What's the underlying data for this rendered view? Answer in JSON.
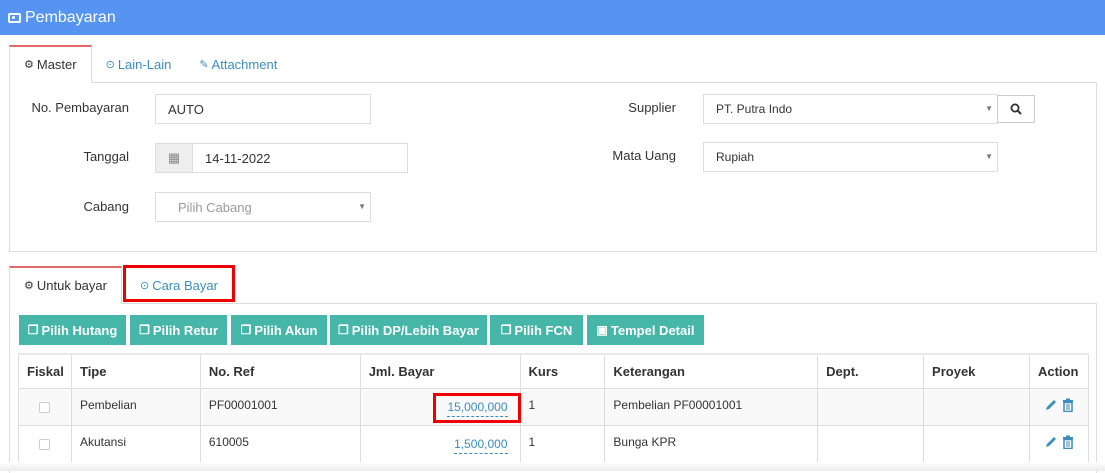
{
  "window": {
    "title": "Pembayaran"
  },
  "top_tabs": [
    {
      "label": "Master"
    },
    {
      "label": "Lain-Lain"
    },
    {
      "label": "Attachment"
    }
  ],
  "form": {
    "no_pembayaran": {
      "label": "No. Pembayaran",
      "value": "AUTO"
    },
    "tanggal": {
      "label": "Tanggal",
      "value": "14-11-2022"
    },
    "cabang": {
      "label": "Cabang",
      "placeholder": "Pilih Cabang"
    },
    "supplier": {
      "label": "Supplier",
      "value": "PT. Putra Indo"
    },
    "mata_uang": {
      "label": "Mata Uang",
      "value": "Rupiah"
    }
  },
  "bottom_tabs": [
    {
      "label": "Untuk bayar"
    },
    {
      "label": "Cara Bayar"
    }
  ],
  "toolbar": [
    {
      "label": "Pilih Hutang"
    },
    {
      "label": "Pilih Retur"
    },
    {
      "label": "Pilih Akun"
    },
    {
      "label": "Pilih DP/Lebih Bayar"
    },
    {
      "label": "Pilih FCN"
    },
    {
      "label": "Tempel Detail"
    }
  ],
  "table": {
    "headers": [
      "Fiskal",
      "Tipe",
      "No. Ref",
      "Jml. Bayar",
      "Kurs",
      "Keterangan",
      "Dept.",
      "Proyek",
      "Action"
    ],
    "rows": [
      {
        "tipe": "Pembelian",
        "no_ref": "PF00001001",
        "jml_bayar": "15,000,000",
        "kurs": "1",
        "keterangan": "Pembelian PF00001001",
        "dept": "",
        "proyek": ""
      },
      {
        "tipe": "Akutansi",
        "no_ref": "610005",
        "jml_bayar": "1,500,000",
        "kurs": "1",
        "keterangan": "Bunga KPR",
        "dept": "",
        "proyek": ""
      }
    ]
  },
  "colors": {
    "header": "#5594f0",
    "button": "#45b6a8",
    "link": "#3c8dbc",
    "highlight": "#ee0000"
  },
  "icons": [
    "money-icon",
    "cogs-icon",
    "check-circle-icon",
    "paperclip-icon",
    "calendar-icon",
    "search-icon",
    "copy-icon",
    "paste-icon",
    "pencil-icon",
    "trash-icon"
  ]
}
